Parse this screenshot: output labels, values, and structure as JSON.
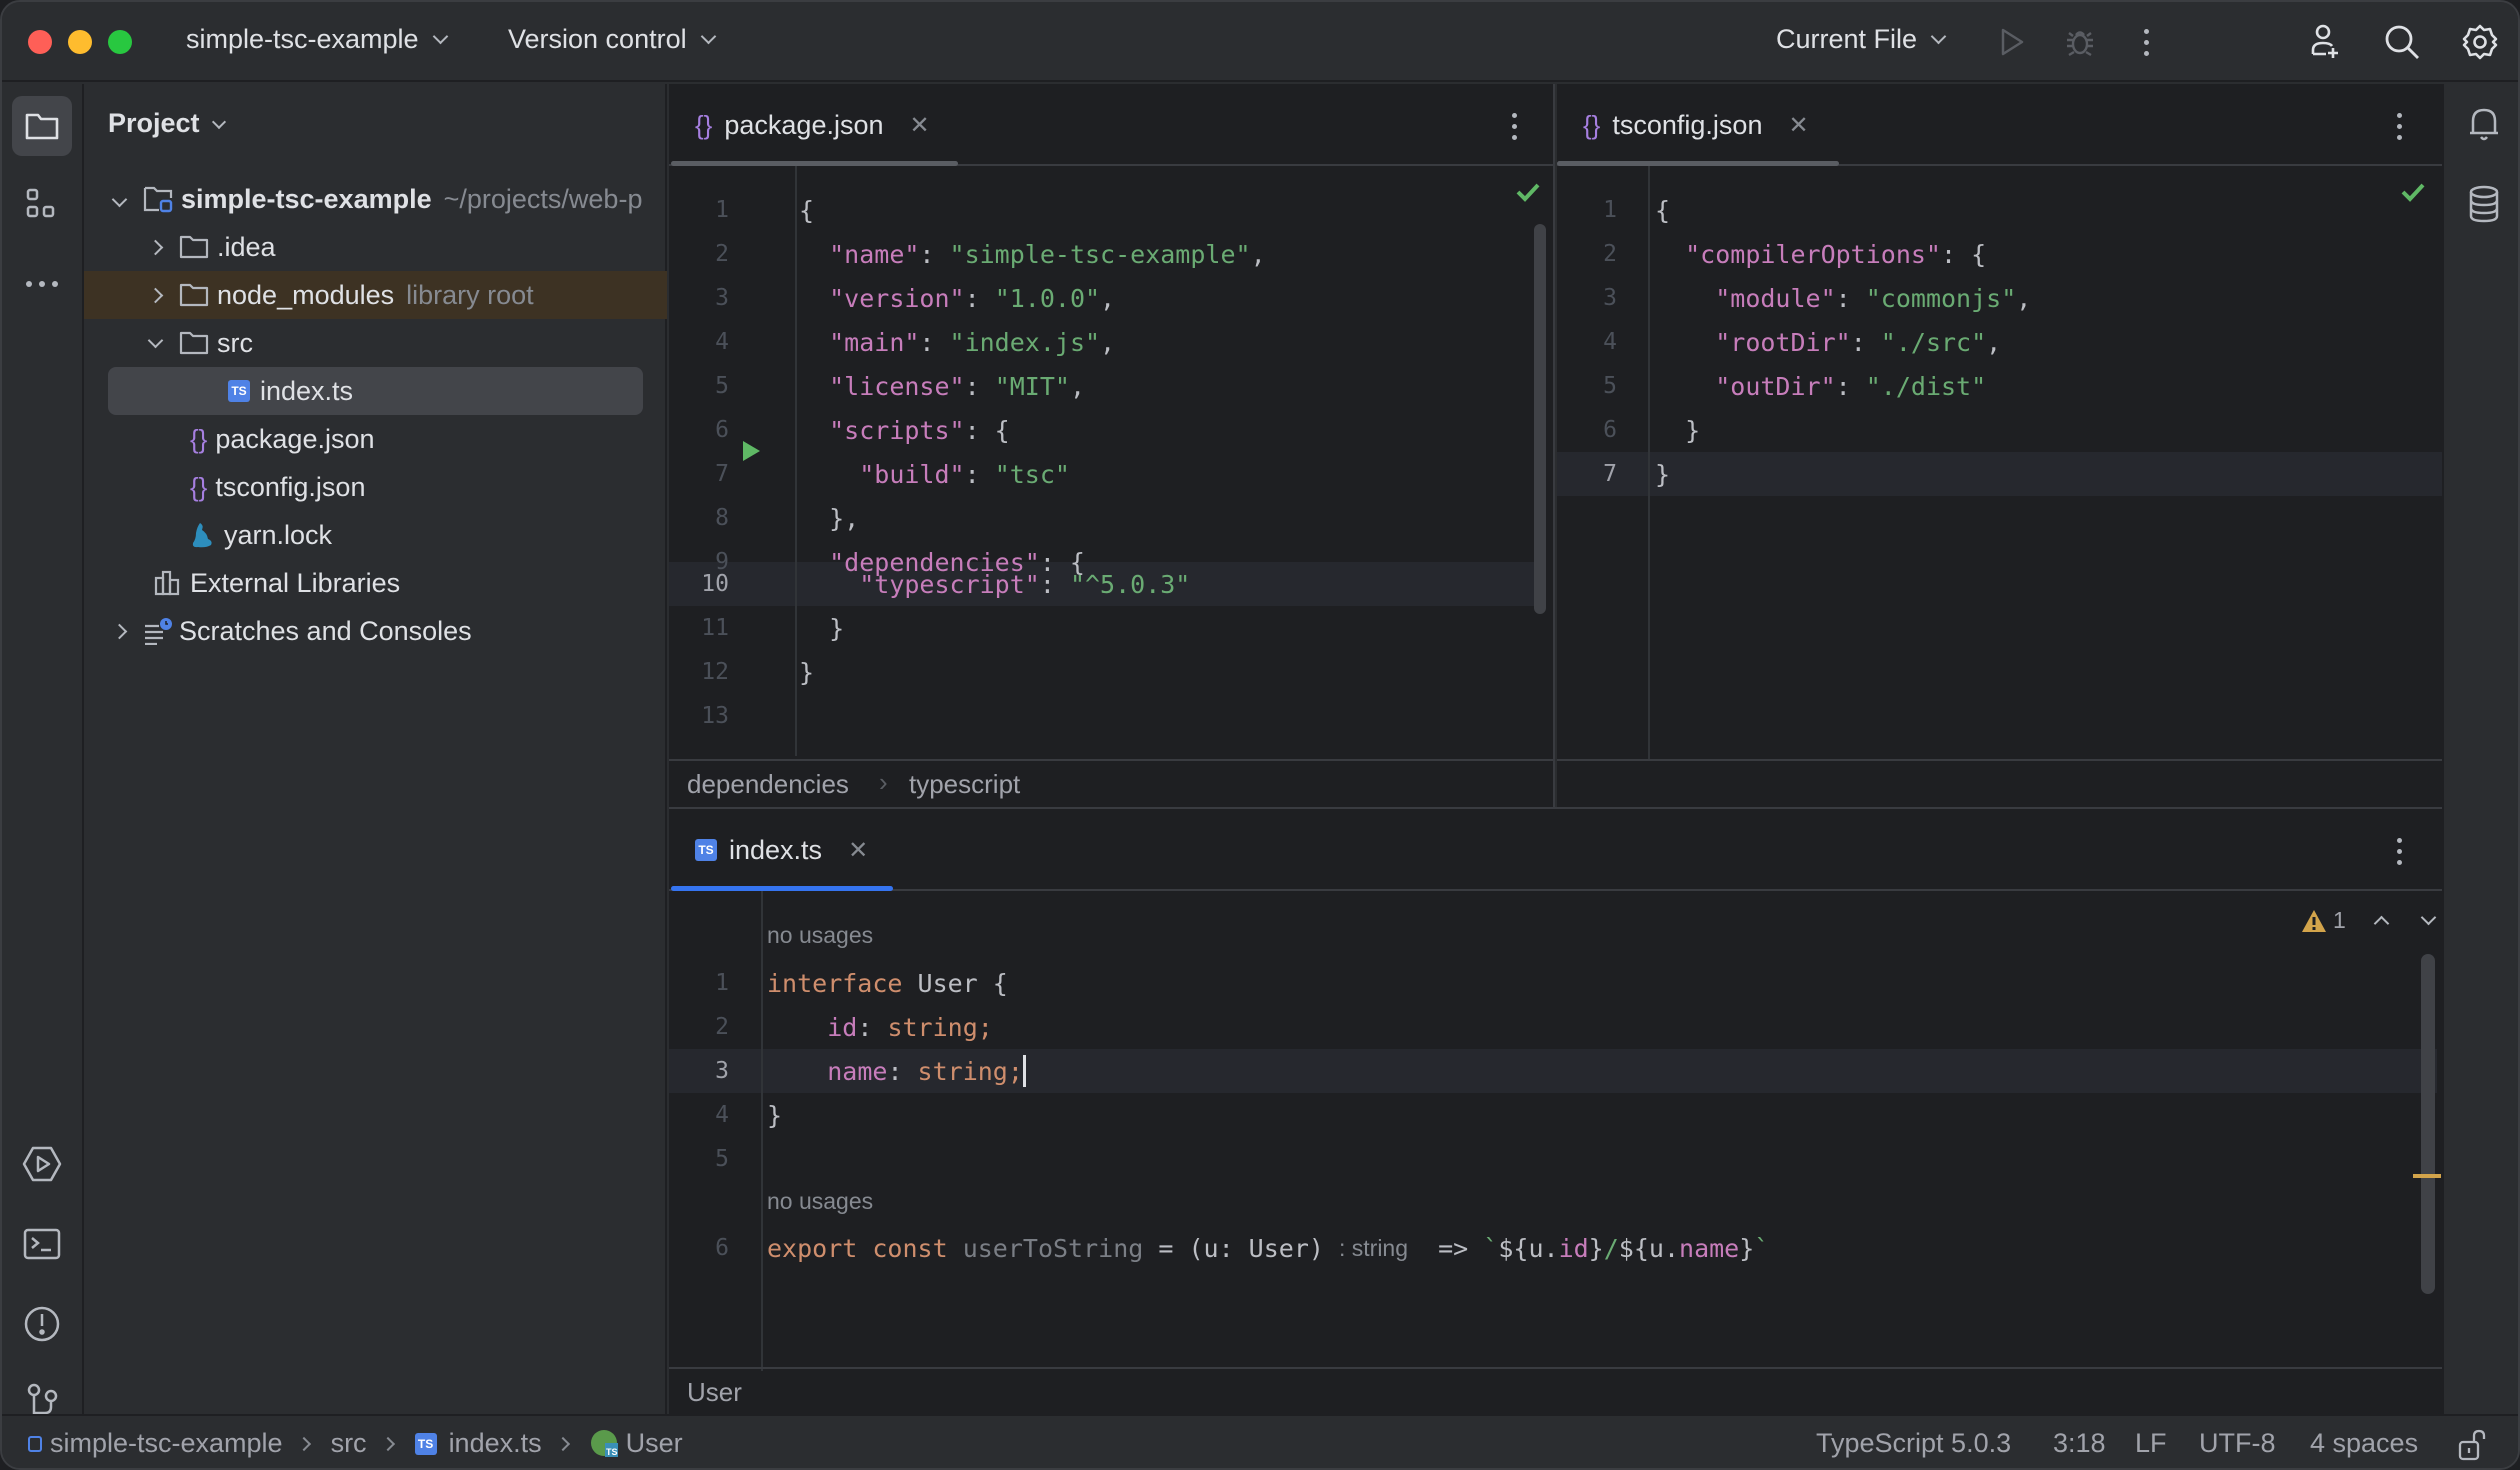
{
  "titlebar": {
    "project_name": "simple-tsc-example",
    "vcs_label": "Version control",
    "run_config": "Current File",
    "icons": [
      "run-icon",
      "debug-icon",
      "more-icon",
      "add-user-icon",
      "search-icon",
      "settings-icon"
    ]
  },
  "left_strip": {
    "top": [
      "folder-icon",
      "structure-icon",
      "more-icon"
    ],
    "bottom": [
      "services-icon",
      "terminal-icon",
      "problems-icon",
      "git-icon"
    ]
  },
  "project_panel": {
    "title": "Project",
    "tree": [
      {
        "label": "simple-tsc-example",
        "hint": "~/projects/web-p",
        "icon": "project-folder-icon",
        "expanded": true,
        "bold": true
      },
      {
        "label": ".idea",
        "icon": "folder-icon",
        "expanded": false
      },
      {
        "label": "node_modules",
        "hint": "library root",
        "icon": "folder-icon",
        "expanded": false
      },
      {
        "label": "src",
        "icon": "folder-icon",
        "expanded": true
      },
      {
        "label": "index.ts",
        "icon": "typescript-file-icon",
        "selected": true
      },
      {
        "label": "package.json",
        "icon": "json-file-icon"
      },
      {
        "label": "tsconfig.json",
        "icon": "json-file-icon"
      },
      {
        "label": "yarn.lock",
        "icon": "yarn-icon"
      },
      {
        "label": "External Libraries",
        "icon": "libraries-icon"
      },
      {
        "label": "Scratches and Consoles",
        "icon": "scratches-icon",
        "expanded": false
      }
    ]
  },
  "editors": {
    "package_json": {
      "tab_label": "package.json",
      "breadcrumb": [
        "dependencies",
        "typescript"
      ],
      "current_line": 10,
      "line_numbers": [
        "1",
        "2",
        "3",
        "4",
        "5",
        "6",
        "7",
        "8",
        "9",
        "10",
        "11",
        "12",
        "13"
      ]
    },
    "tsconfig_json": {
      "tab_label": "tsconfig.json",
      "current_line": 7,
      "line_numbers": [
        "1",
        "2",
        "3",
        "4",
        "5",
        "6",
        "7"
      ]
    },
    "index_ts": {
      "tab_label": "index.ts",
      "inlay_no_usages": "no usages",
      "inlay_return_type": ": string",
      "warning_count": "1",
      "breadcrumb": "User",
      "current_line": 3,
      "line_numbers": [
        "1",
        "2",
        "3",
        "4",
        "5",
        "6"
      ]
    }
  },
  "statusbar": {
    "path": [
      "simple-tsc-example",
      "src",
      "index.ts",
      "User"
    ],
    "language": "TypeScript 5.0.3",
    "cursor": "3:18",
    "line_ending": "LF",
    "encoding": "UTF-8",
    "indent": "4 spaces"
  },
  "colors": {
    "accent": "#3574f0",
    "json_key": "#c77dbb",
    "string": "#6aab73",
    "keyword": "#cf8e6d",
    "warning": "#d3a44b",
    "library_root_bg": "#3d3223"
  }
}
